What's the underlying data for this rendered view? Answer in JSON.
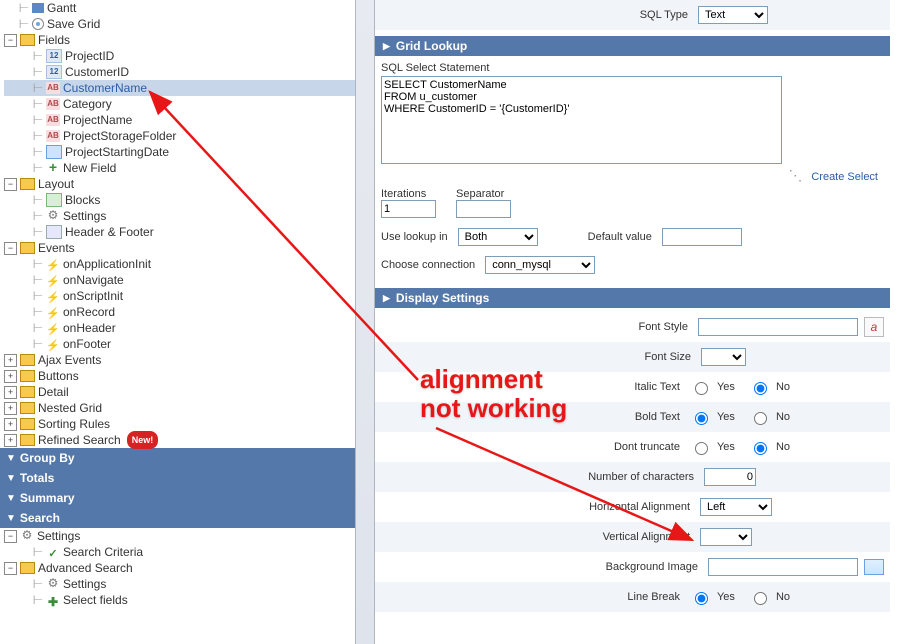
{
  "tree": {
    "gantt": "Gantt",
    "save_grid": "Save Grid",
    "fields": "Fields",
    "project_id": "ProjectID",
    "customer_id": "CustomerID",
    "customer_name": "CustomerName",
    "category": "Category",
    "project_name": "ProjectName",
    "project_storage_folder": "ProjectStorageFolder",
    "project_starting_date": "ProjectStartingDate",
    "new_field": "New Field",
    "layout": "Layout",
    "blocks": "Blocks",
    "settings": "Settings",
    "header_footer": "Header & Footer",
    "events": "Events",
    "on_application_init": "onApplicationInit",
    "on_navigate": "onNavigate",
    "on_script_init": "onScriptInit",
    "on_record": "onRecord",
    "on_header": "onHeader",
    "on_footer": "onFooter",
    "ajax_events": "Ajax Events",
    "buttons": "Buttons",
    "detail": "Detail",
    "nested_grid": "Nested Grid",
    "sorting_rules": "Sorting Rules",
    "refined_search": "Refined Search",
    "new_badge": "New!",
    "group_by": "Group By",
    "totals": "Totals",
    "summary": "Summary",
    "search_hdr": "Search",
    "search_settings": "Settings",
    "search_criteria": "Search Criteria",
    "adv_search": "Advanced Search",
    "adv_settings": "Settings",
    "adv_select_fields": "Select fields"
  },
  "form": {
    "sql_type_label": "SQL Type",
    "sql_type_value": "Text",
    "yes": "Yes",
    "no": "No",
    "grid_lookup": "Grid Lookup",
    "sql_select_stmt_label": "SQL Select Statement",
    "sql_select_stmt_value": "SELECT CustomerName\nFROM u_customer\nWHERE CustomerID = '{CustomerID}'",
    "create_select": "Create Select",
    "iterations_label": "Iterations",
    "iterations_value": "1",
    "separator_label": "Separator",
    "separator_value": "",
    "use_lookup_in_label": "Use lookup in",
    "use_lookup_in_value": "Both",
    "default_value_label": "Default value",
    "default_value": "",
    "choose_conn_label": "Choose connection",
    "choose_conn_value": "conn_mysql",
    "display_settings": "Display Settings",
    "font_style_label": "Font Style",
    "font_size_label": "Font Size",
    "italic_label": "Italic Text",
    "bold_label": "Bold Text",
    "dont_truncate_label": "Dont truncate",
    "num_chars_label": "Number of characters",
    "num_chars_value": "0",
    "horiz_align_label": "Horizontal Alignment",
    "horiz_align_value": "Left",
    "vert_align_label": "Vertical Alignment",
    "bg_image_label": "Background Image",
    "line_break_label": "Line Break"
  },
  "annotation": {
    "text": "alignment\nnot working"
  }
}
